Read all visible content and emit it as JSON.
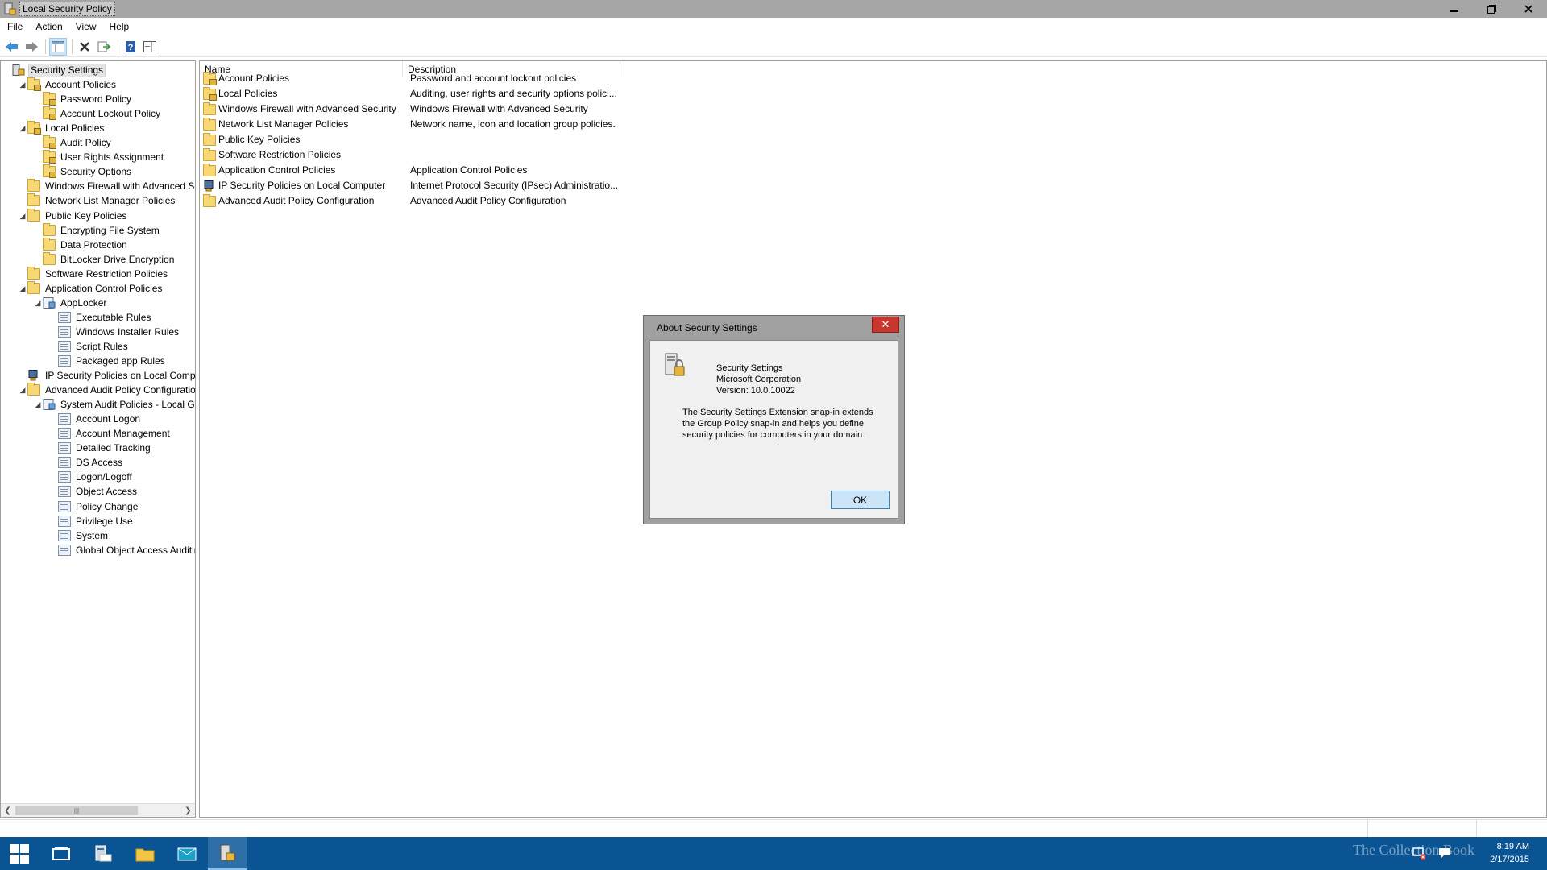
{
  "window": {
    "title": "Local Security Policy"
  },
  "menu": [
    "File",
    "Action",
    "View",
    "Help"
  ],
  "tree": [
    {
      "label": "Security Settings",
      "level": 0,
      "expand": "",
      "icon": "security-settings-icon"
    },
    {
      "label": "Account Policies",
      "level": 1,
      "expand": "◢",
      "icon": "folder-lock-icon"
    },
    {
      "label": "Password Policy",
      "level": 2,
      "expand": "",
      "icon": "folder-lock-icon"
    },
    {
      "label": "Account Lockout Policy",
      "level": 2,
      "expand": "",
      "icon": "folder-lock-icon"
    },
    {
      "label": "Local Policies",
      "level": 1,
      "expand": "◢",
      "icon": "folder-lock-icon"
    },
    {
      "label": "Audit Policy",
      "level": 2,
      "expand": "",
      "icon": "folder-lock-icon"
    },
    {
      "label": "User Rights Assignment",
      "level": 2,
      "expand": "",
      "icon": "folder-lock-icon"
    },
    {
      "label": "Security Options",
      "level": 2,
      "expand": "",
      "icon": "folder-lock-icon"
    },
    {
      "label": "Windows Firewall with Advanced Security",
      "level": 1,
      "expand": "",
      "icon": "folder-icon"
    },
    {
      "label": "Network List Manager Policies",
      "level": 1,
      "expand": "",
      "icon": "folder-icon"
    },
    {
      "label": "Public Key Policies",
      "level": 1,
      "expand": "◢",
      "icon": "folder-icon"
    },
    {
      "label": "Encrypting File System",
      "level": 2,
      "expand": "",
      "icon": "folder-icon"
    },
    {
      "label": "Data Protection",
      "level": 2,
      "expand": "",
      "icon": "folder-icon"
    },
    {
      "label": "BitLocker Drive Encryption",
      "level": 2,
      "expand": "",
      "icon": "folder-icon"
    },
    {
      "label": "Software Restriction Policies",
      "level": 1,
      "expand": "",
      "icon": "folder-icon"
    },
    {
      "label": "Application Control Policies",
      "level": 1,
      "expand": "◢",
      "icon": "folder-icon"
    },
    {
      "label": "AppLocker",
      "level": 2,
      "expand": "◢",
      "icon": "applocker-icon"
    },
    {
      "label": "Executable Rules",
      "level": 3,
      "expand": "",
      "icon": "executable-rules-icon"
    },
    {
      "label": "Windows Installer Rules",
      "level": 3,
      "expand": "",
      "icon": "installer-rules-icon"
    },
    {
      "label": "Script Rules",
      "level": 3,
      "expand": "",
      "icon": "script-rules-icon"
    },
    {
      "label": "Packaged app Rules",
      "level": 3,
      "expand": "",
      "icon": "packaged-app-rules-icon"
    },
    {
      "label": "IP Security Policies on Local Computer",
      "level": 1,
      "expand": "",
      "icon": "ipsec-icon"
    },
    {
      "label": "Advanced Audit Policy Configuration",
      "level": 1,
      "expand": "◢",
      "icon": "folder-icon"
    },
    {
      "label": "System Audit Policies - Local Group Policy Object",
      "level": 2,
      "expand": "◢",
      "icon": "audit-policies-icon"
    },
    {
      "label": "Account Logon",
      "level": 3,
      "expand": "",
      "icon": "audit-category-icon"
    },
    {
      "label": "Account Management",
      "level": 3,
      "expand": "",
      "icon": "audit-category-icon"
    },
    {
      "label": "Detailed Tracking",
      "level": 3,
      "expand": "",
      "icon": "audit-category-icon"
    },
    {
      "label": "DS Access",
      "level": 3,
      "expand": "",
      "icon": "audit-category-icon"
    },
    {
      "label": "Logon/Logoff",
      "level": 3,
      "expand": "",
      "icon": "audit-category-icon"
    },
    {
      "label": "Object Access",
      "level": 3,
      "expand": "",
      "icon": "audit-category-icon"
    },
    {
      "label": "Policy Change",
      "level": 3,
      "expand": "",
      "icon": "audit-category-icon"
    },
    {
      "label": "Privilege Use",
      "level": 3,
      "expand": "",
      "icon": "audit-category-icon"
    },
    {
      "label": "System",
      "level": 3,
      "expand": "",
      "icon": "audit-category-icon"
    },
    {
      "label": "Global Object Access Auditing",
      "level": 3,
      "expand": "",
      "icon": "audit-category-icon"
    }
  ],
  "list": {
    "columns": [
      "Name",
      "Description"
    ],
    "rows": [
      {
        "name": "Account Policies",
        "description": "Password and account lockout policies",
        "icon": "folder-lock-icon"
      },
      {
        "name": "Local Policies",
        "description": "Auditing, user rights and security options polici...",
        "icon": "folder-lock-icon"
      },
      {
        "name": "Windows Firewall with Advanced Security",
        "description": "Windows Firewall with Advanced Security",
        "icon": "folder-icon"
      },
      {
        "name": "Network List Manager Policies",
        "description": "Network name, icon and location group policies.",
        "icon": "folder-icon"
      },
      {
        "name": "Public Key Policies",
        "description": "",
        "icon": "folder-icon"
      },
      {
        "name": "Software Restriction Policies",
        "description": "",
        "icon": "folder-icon"
      },
      {
        "name": "Application Control Policies",
        "description": "Application Control Policies",
        "icon": "folder-icon"
      },
      {
        "name": "IP Security Policies on Local Computer",
        "description": "Internet Protocol Security (IPsec) Administratio...",
        "icon": "ipsec-icon"
      },
      {
        "name": "Advanced Audit Policy Configuration",
        "description": "Advanced Audit Policy Configuration",
        "icon": "folder-icon"
      }
    ]
  },
  "dialog": {
    "title": "About Security Settings",
    "product": "Security Settings",
    "company": "Microsoft Corporation",
    "version": "Version: 10.0.10022",
    "description": "The Security Settings Extension snap-in extends the Group Policy snap-in and helps you define security policies for computers in your domain.",
    "ok_label": "OK"
  },
  "taskbar": {
    "time": "8:19 AM",
    "date": "2/17/2015",
    "watermark": "The Collection Book"
  },
  "colors": {
    "titlebar": "#a6a6a6",
    "taskbar": "#0a5493",
    "dialog_close": "#c7372f",
    "ok_button": "#cce4f7",
    "folder": "#f8d775"
  }
}
